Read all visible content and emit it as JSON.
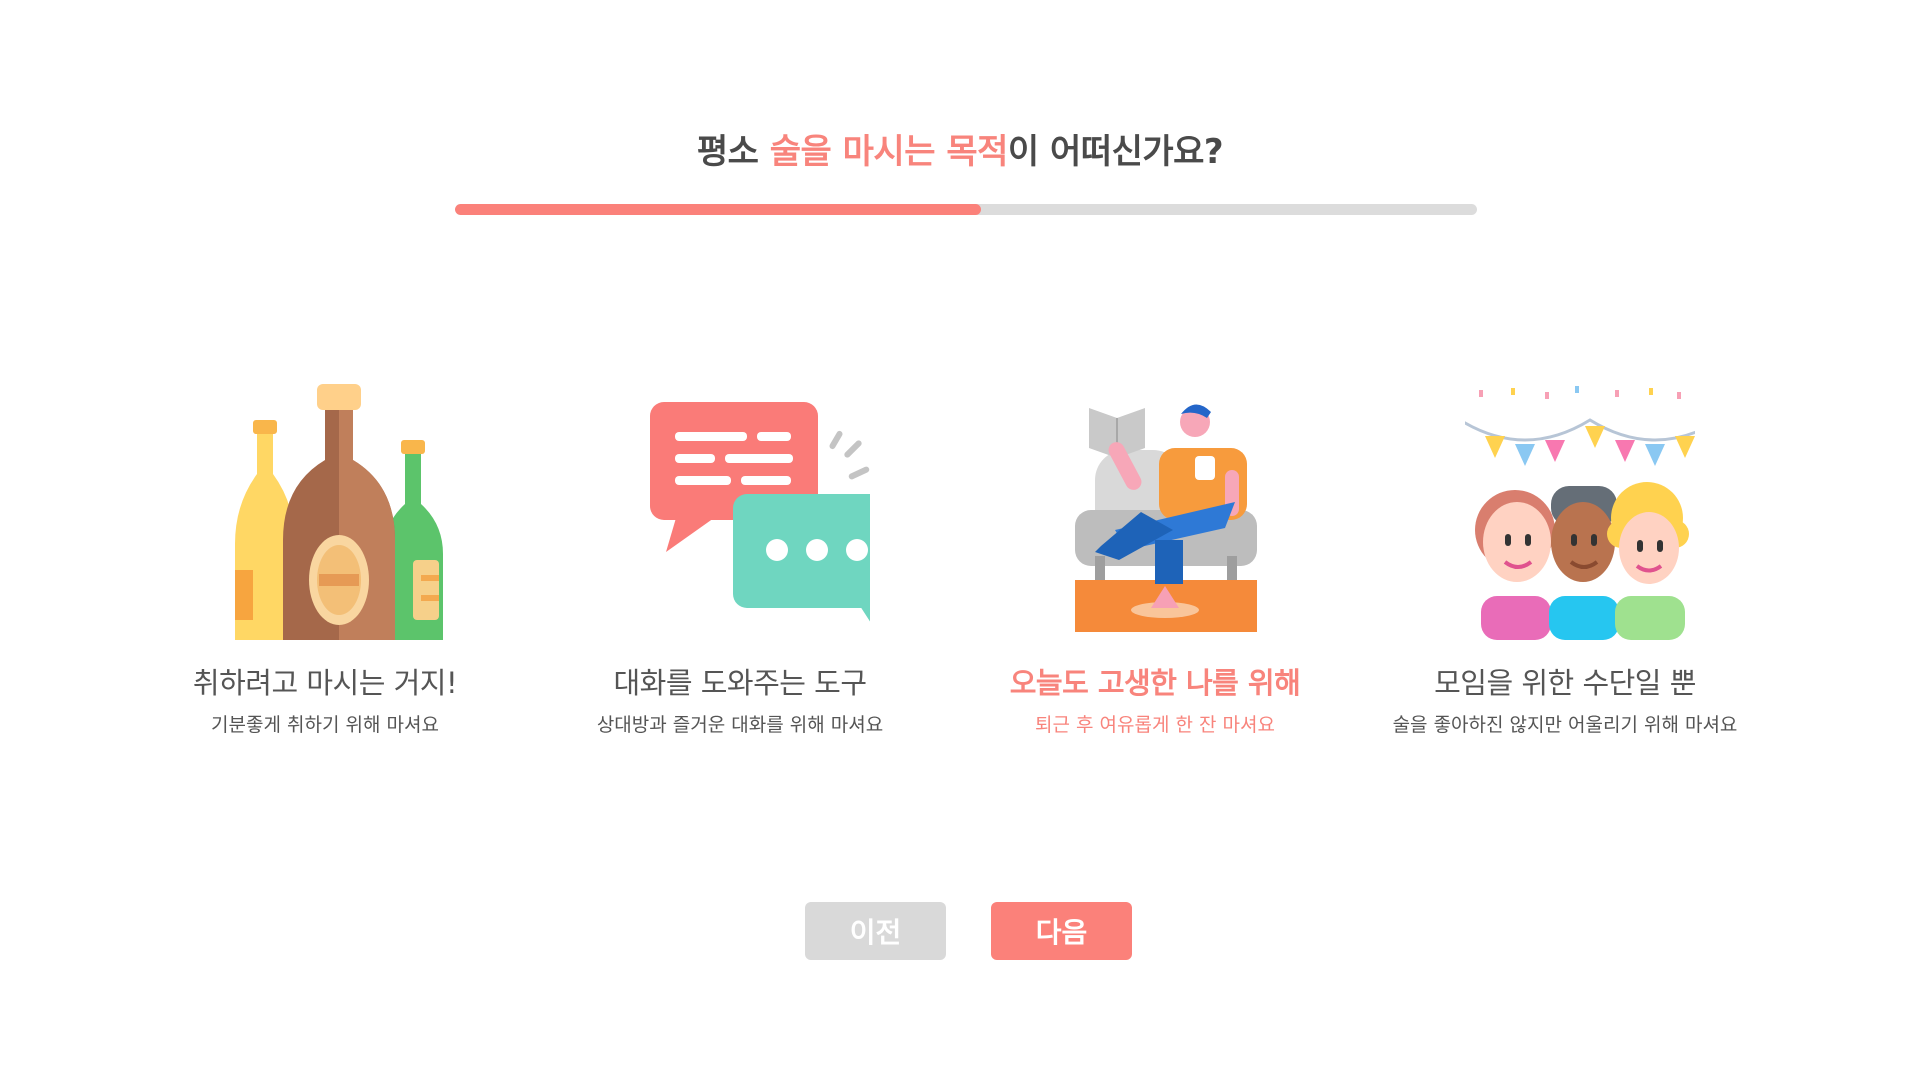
{
  "question": {
    "prefix": "평소 ",
    "highlight": "술을 마시는 목적",
    "suffix": "이 어떠신가요?"
  },
  "progress": {
    "fraction": 0.515,
    "fill_color": "#fb817a",
    "track_color": "#dcdcdc"
  },
  "options": [
    {
      "label": "취하려고 마시는 거지!",
      "desc": "기분좋게 취하기 위해 마셔요",
      "icon": "bottles-icon",
      "selected": false
    },
    {
      "label": "대화를 도와주는 도구",
      "desc": "상대방과 즐거운 대화를 위해 마셔요",
      "icon": "chat-bubbles-icon",
      "selected": false
    },
    {
      "label": "오늘도 고생한 나를 위해",
      "desc": "퇴근 후 여유롭게 한 잔 마셔요",
      "icon": "relaxing-person-icon",
      "selected": true
    },
    {
      "label": "모임을 위한 수단일 뿐",
      "desc": "술을 좋아하진 않지만 어울리기 위해 마셔요",
      "icon": "party-people-icon",
      "selected": false
    }
  ],
  "buttons": {
    "prev_label": "이전",
    "next_label": "다음"
  },
  "colors": {
    "accent": "#f8847c",
    "text": "#4a4a4a",
    "button_disabled": "#d9d9d9"
  }
}
